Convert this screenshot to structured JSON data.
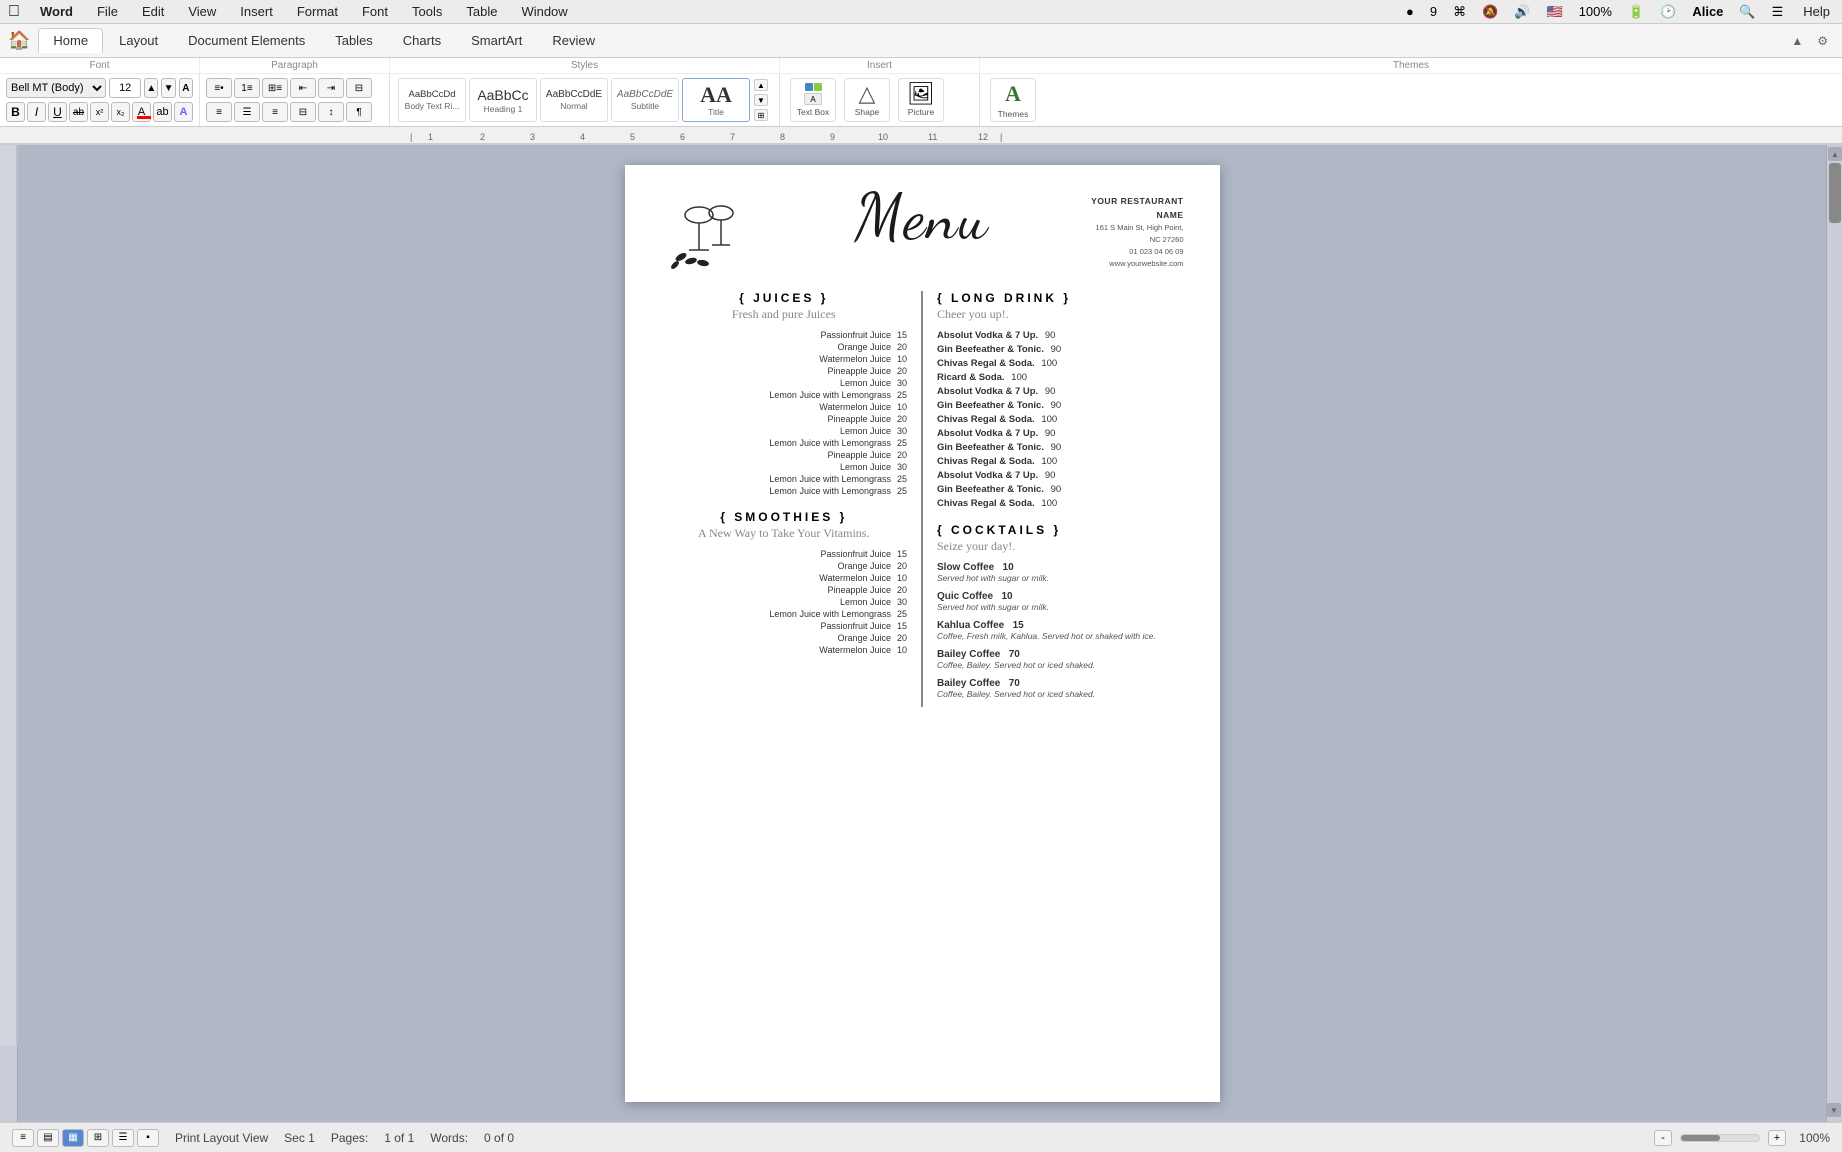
{
  "menubar": {
    "apple": "⌘",
    "items": [
      "Word",
      "File",
      "Edit",
      "View",
      "Insert",
      "Format",
      "Font",
      "Tools",
      "Table",
      "Window",
      "Help"
    ]
  },
  "ribbon": {
    "tabs": [
      "Home",
      "Layout",
      "Document Elements",
      "Tables",
      "Charts",
      "SmartArt",
      "Review"
    ],
    "active_tab": "Home"
  },
  "font_section": {
    "label": "Font",
    "font_name": "Bell MT (Body)",
    "font_size": "12",
    "bold": "B",
    "italic": "I",
    "underline": "U"
  },
  "paragraph_section": {
    "label": "Paragraph"
  },
  "styles_section": {
    "label": "Styles",
    "styles": [
      {
        "name": "Body Text Ri...",
        "preview": "AaBbCcDd"
      },
      {
        "name": "Heading 1",
        "preview": "AaBbCc"
      },
      {
        "name": "Normal",
        "preview": "AaBbCcDdE"
      },
      {
        "name": "Subtitle",
        "preview": "AaBbCcDdE"
      },
      {
        "name": "Title",
        "preview": "AA"
      }
    ]
  },
  "insert_section": {
    "label": "Insert",
    "items": [
      {
        "name": "Text Box",
        "icon": "⬜"
      },
      {
        "name": "Shape",
        "icon": "△"
      },
      {
        "name": "Picture",
        "icon": "🖼"
      }
    ],
    "themes_label": "Themes",
    "themes_icon": "A"
  },
  "document": {
    "restaurant_name": "YOUR RESTAURANT NAME",
    "address": "161 S Main St, High Point,",
    "city": "NC 27260",
    "phone": "01 023 04 06 09",
    "website": "www.yourwebsite.com",
    "menu_title": "Menu",
    "sections": {
      "juices": {
        "title": "{ JUICES }",
        "subtitle": "Fresh and pure Juices",
        "items": [
          {
            "name": "Passionfruit Juice",
            "price": "15"
          },
          {
            "name": "Orange Juice",
            "price": "20"
          },
          {
            "name": "Watermelon Juice",
            "price": "10"
          },
          {
            "name": "Pineapple Juice",
            "price": "20"
          },
          {
            "name": "Lemon Juice",
            "price": "30"
          },
          {
            "name": "Lemon Juice with Lemongrass",
            "price": "25"
          },
          {
            "name": "Watermelon Juice",
            "price": "10"
          },
          {
            "name": "Pineapple Juice",
            "price": "20"
          },
          {
            "name": "Lemon Juice",
            "price": "30"
          },
          {
            "name": "Lemon Juice with Lemongrass",
            "price": "25"
          },
          {
            "name": "Pineapple Juice",
            "price": "20"
          },
          {
            "name": "Lemon Juice",
            "price": "30"
          },
          {
            "name": "Lemon Juice with Lemongrass",
            "price": "25"
          },
          {
            "name": "Lemon Juice with Lemongrass",
            "price": "25"
          }
        ]
      },
      "smoothies": {
        "title": "{ SMOOTHIES }",
        "subtitle": "A New Way to Take Your Vitamins.",
        "items": [
          {
            "name": "Passionfruit Juice",
            "price": "15"
          },
          {
            "name": "Orange Juice",
            "price": "20"
          },
          {
            "name": "Watermelon Juice",
            "price": "10"
          },
          {
            "name": "Pineapple Juice",
            "price": "20"
          },
          {
            "name": "Lemon Juice",
            "price": "30"
          },
          {
            "name": "Lemon Juice with Lemongrass",
            "price": "25"
          },
          {
            "name": "Passionfruit Juice",
            "price": "15"
          },
          {
            "name": "Orange Juice",
            "price": "20"
          },
          {
            "name": "Watermelon Juice",
            "price": "10"
          }
        ]
      },
      "long_drink": {
        "title": "{ LONG DRINK }",
        "subtitle": "Cheer you up!.",
        "items": [
          {
            "name": "Absolut Vodka & 7 Up.",
            "price": "90"
          },
          {
            "name": "Gin Beefeather & Tonic.",
            "price": "90"
          },
          {
            "name": "Chivas Regal & Soda.",
            "price": "100"
          },
          {
            "name": "Ricard & Soda.",
            "price": "100"
          },
          {
            "name": "Absolut Vodka & 7 Up.",
            "price": "90"
          },
          {
            "name": "Gin Beefeather & Tonic.",
            "price": "90"
          },
          {
            "name": "Chivas Regal & Soda.",
            "price": "100"
          },
          {
            "name": "Absolut Vodka & 7 Up.",
            "price": "90"
          },
          {
            "name": "Gin Beefeather & Tonic.",
            "price": "90"
          },
          {
            "name": "Chivas Regal & Soda.",
            "price": "100"
          },
          {
            "name": "Absolut Vodka & 7 Up.",
            "price": "90"
          },
          {
            "name": "Gin Beefeather & Tonic.",
            "price": "90"
          },
          {
            "name": "Chivas Regal & Soda.",
            "price": "100"
          }
        ]
      },
      "cocktails": {
        "title": "{ COCKTAILS }",
        "subtitle": "Seize your day!.",
        "items": [
          {
            "name": "Slow Coffee",
            "price": "10",
            "desc": "Served hot with sugar or milk."
          },
          {
            "name": "Quic Coffee",
            "price": "10",
            "desc": "Served hot with sugar or milk."
          },
          {
            "name": "Kahlua Coffee",
            "price": "15",
            "desc": "Coffee, Fresh milk, Kahlua. Served hot or shaked with ice."
          },
          {
            "name": "Bailey Coffee",
            "price": "70",
            "desc": "Coffee, Bailey. Served hot or iced shaked."
          },
          {
            "name": "Bailey Coffee",
            "price": "70",
            "desc": "Coffee, Bailey. Served hot or iced shaked."
          }
        ]
      }
    }
  },
  "status_bar": {
    "view_label": "Print Layout View",
    "section": "Sec    1",
    "pages_label": "Pages:",
    "pages_value": "1 of 1",
    "words_label": "Words:",
    "words_value": "0 of 0",
    "zoom": "100%",
    "view_buttons": [
      "≡",
      "≡",
      "⊞",
      "▤",
      "▦",
      "▪"
    ]
  },
  "colors": {
    "background": "#b0b8c8",
    "toolbar_bg": "#ffffff",
    "menubar_bg": "#ececec",
    "active_tab": "#5588cc",
    "accent": "#6699cc"
  }
}
